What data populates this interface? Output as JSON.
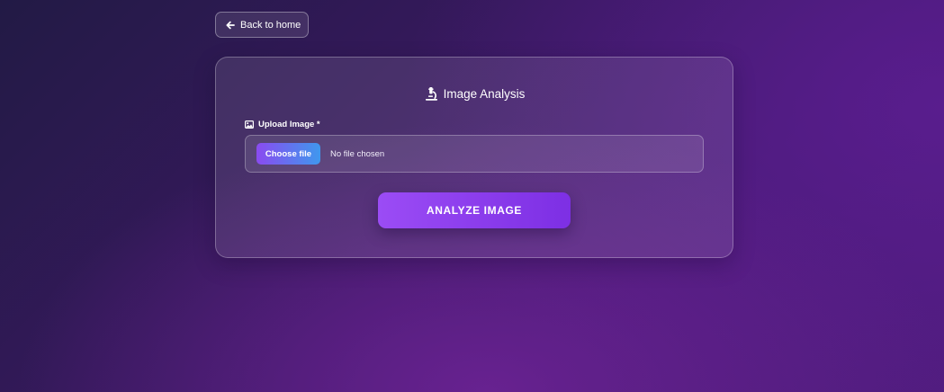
{
  "nav": {
    "back_label": "Back to home",
    "back_icon": "arrow-left-icon"
  },
  "card": {
    "title": "Image Analysis",
    "title_icon": "microscope-icon",
    "upload_label": "Upload Image *",
    "upload_icon": "image-icon",
    "file_input": {
      "button_label": "Choose file",
      "status": "No file chosen"
    },
    "analyze_label": "ANALYZE IMAGE"
  },
  "colors": {
    "background_dark": "#221a45",
    "background_purple": "#4d1c7a",
    "accent_purple": "#9b4cf5",
    "accent_blue": "#3f98ee"
  }
}
